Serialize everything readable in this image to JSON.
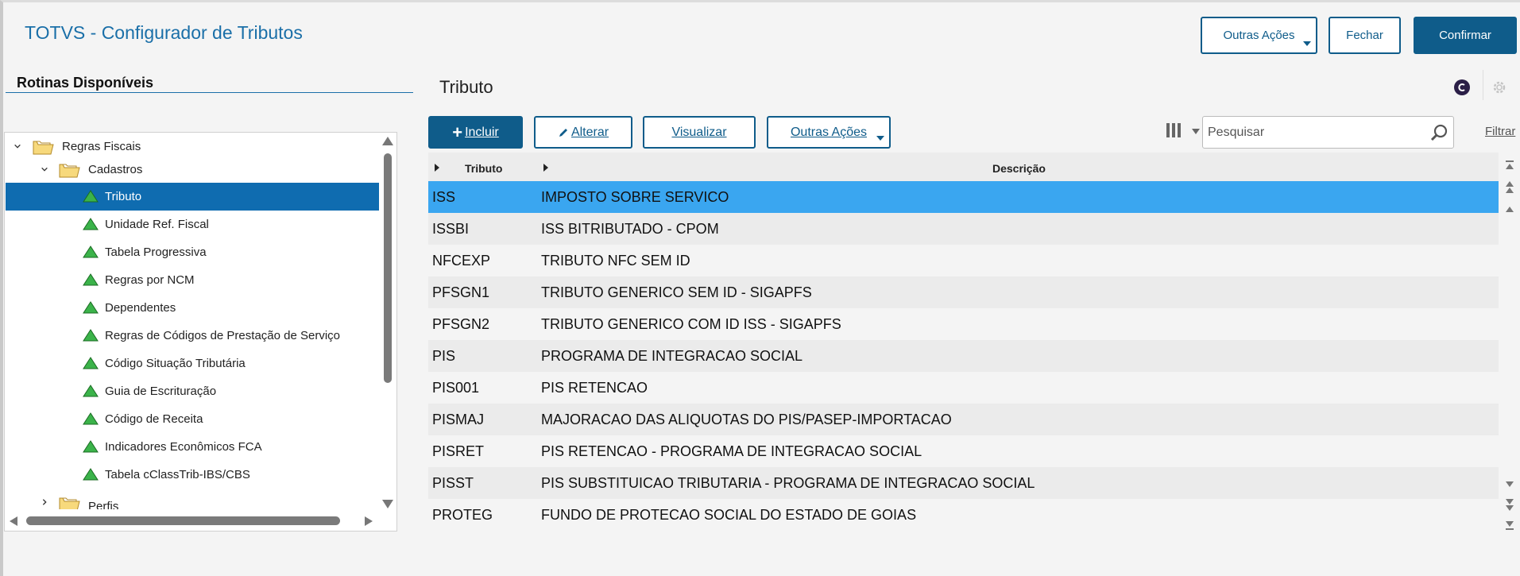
{
  "app": {
    "title": "TOTVS - Configurador de Tributos"
  },
  "header": {
    "other_actions": "Outras Ações",
    "close": "Fechar",
    "confirm": "Confirmar"
  },
  "left_panel": {
    "title": "Rotinas Disponíveis",
    "tree": {
      "root": "Regras Fiscais",
      "cadastros": "Cadastros",
      "items": [
        "Tributo",
        "Unidade Ref. Fiscal",
        "Tabela Progressiva",
        "Regras por NCM",
        "Dependentes",
        "Regras de Códigos de Prestação de Serviço",
        "Código Situação Tributária",
        "Guia de Escrituração",
        "Código de Receita",
        "Indicadores Econômicos FCA",
        "Tabela cClassTrib-IBS/CBS"
      ],
      "perfis": "Perfis",
      "selected": "Tributo"
    }
  },
  "main": {
    "title": "Tributo",
    "toolbar": {
      "include": "Incluir",
      "edit": "Alterar",
      "view": "Visualizar",
      "other_actions": "Outras Ações"
    },
    "search": {
      "placeholder": "Pesquisar"
    },
    "filter": "Filtrar",
    "grid": {
      "columns": [
        "Tributo",
        "Descrição"
      ],
      "rows": [
        {
          "code": "ISS",
          "desc": "IMPOSTO SOBRE SERVICO"
        },
        {
          "code": "ISSBI",
          "desc": "ISS BITRIBUTADO - CPOM"
        },
        {
          "code": "NFCEXP",
          "desc": "TRIBUTO NFC SEM ID"
        },
        {
          "code": "PFSGN1",
          "desc": "TRIBUTO GENERICO SEM ID - SIGAPFS"
        },
        {
          "code": "PFSGN2",
          "desc": "TRIBUTO GENERICO COM ID ISS - SIGAPFS"
        },
        {
          "code": "PIS",
          "desc": "PROGRAMA DE INTEGRACAO SOCIAL"
        },
        {
          "code": "PIS001",
          "desc": "PIS RETENCAO"
        },
        {
          "code": "PISMAJ",
          "desc": "MAJORACAO DAS ALIQUOTAS DO PIS/PASEP-IMPORTACAO"
        },
        {
          "code": "PISRET",
          "desc": "PIS RETENCAO - PROGRAMA DE INTEGRACAO SOCIAL"
        },
        {
          "code": "PISST",
          "desc": "PIS SUBSTITUICAO TRIBUTARIA - PROGRAMA DE INTEGRACAO SOCIAL"
        },
        {
          "code": "PROTEG",
          "desc": "FUNDO DE PROTECAO SOCIAL DO ESTADO DE GOIAS"
        }
      ],
      "selected_row": "ISS"
    }
  },
  "colors": {
    "brand": "#0f5c8a",
    "title": "#1a6fa8",
    "tree_selected": "#0f6cb0",
    "row_selected": "#3aa6f0",
    "row_alt": "#ebebeb"
  },
  "icons": [
    "folder-icon",
    "green-triangle-icon",
    "chevron-down-icon",
    "chevron-right-icon",
    "pencil-icon",
    "plus-icon",
    "columns-icon",
    "search-icon",
    "gear-icon",
    "totvs-circle-icon"
  ]
}
